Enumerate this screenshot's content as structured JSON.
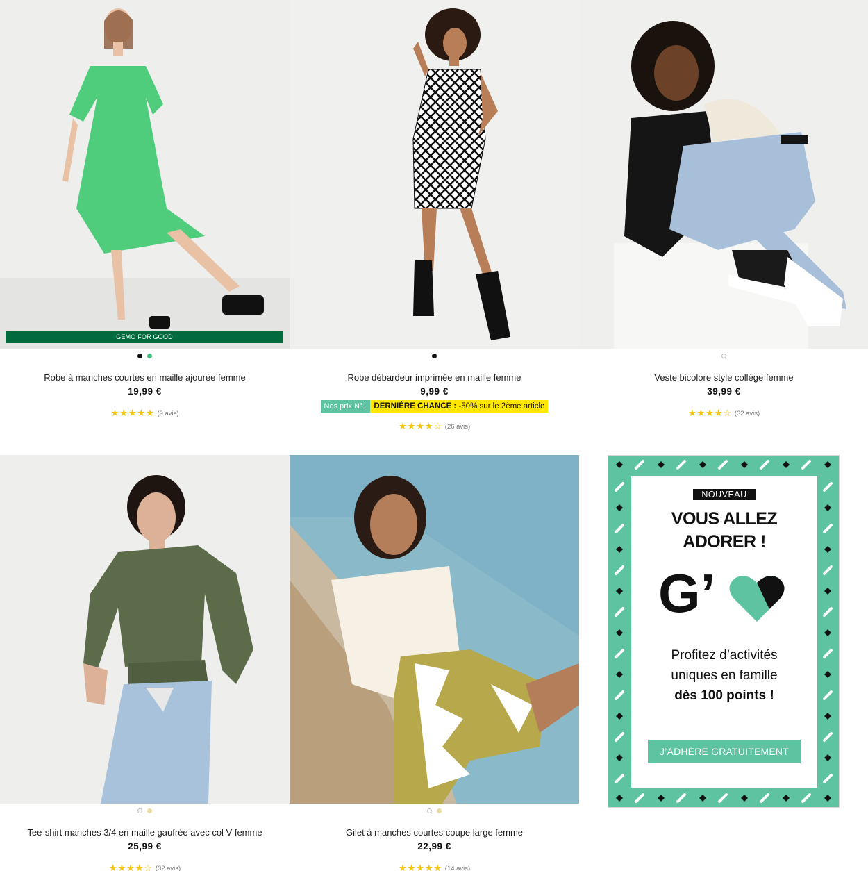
{
  "products": [
    {
      "title": "Robe à manches courtes en maille ajourée femme",
      "price": "19,99 €",
      "badge": "GEMO FOR GOOD",
      "stars": "★★★★★",
      "reviews": "(9 avis)",
      "swatches": [
        "#111111",
        "#3dbb7d"
      ],
      "image": "woman-green-dress-icon"
    },
    {
      "title": "Robe débardeur imprimée en maille femme",
      "price": "9,99 €",
      "promo_tag": "Nos prix N°1",
      "promo_offer_bold": "DERNIÈRE CHANCE :",
      "promo_offer_rest": " -50% sur le 2ème article",
      "stars": "★★★★☆",
      "reviews": "(26 avis)",
      "swatches": [
        "#111111"
      ],
      "image": "woman-printed-dress-icon"
    },
    {
      "title": "Veste bicolore style collège femme",
      "price": "39,99 €",
      "stars": "★★★★☆",
      "reviews": "(32 avis)",
      "swatches": [
        "#ffffff"
      ],
      "image": "woman-college-jacket-icon"
    },
    {
      "title": "Tee-shirt manches 3/4 en maille gaufrée avec col V femme",
      "price": "25,99 €",
      "stars": "★★★★☆",
      "reviews": "(32 avis)",
      "swatches": [
        "#ffffff",
        "#e8dca0"
      ],
      "image": "woman-khaki-top-icon"
    },
    {
      "title": "Gilet à manches courtes coupe large femme",
      "price": "22,99 €",
      "stars": "★★★★★",
      "reviews": "(14 avis)",
      "swatches": [
        "#ffffff",
        "#e8dca0"
      ],
      "image": "woman-white-cardigan-icon"
    }
  ],
  "promo": {
    "tag": "NOUVEAU",
    "headline_1": "VOUS ALLEZ",
    "headline_2": "ADORER !",
    "logo_letter": "G’",
    "body_1": "Profitez d’activités",
    "body_2": "uniques en famille",
    "body_3": "dès 100 points !",
    "cta": "J’ADHÈRE GRATUITEMENT",
    "colors": {
      "accent": "#5dc3a1",
      "dark": "#111111"
    }
  }
}
